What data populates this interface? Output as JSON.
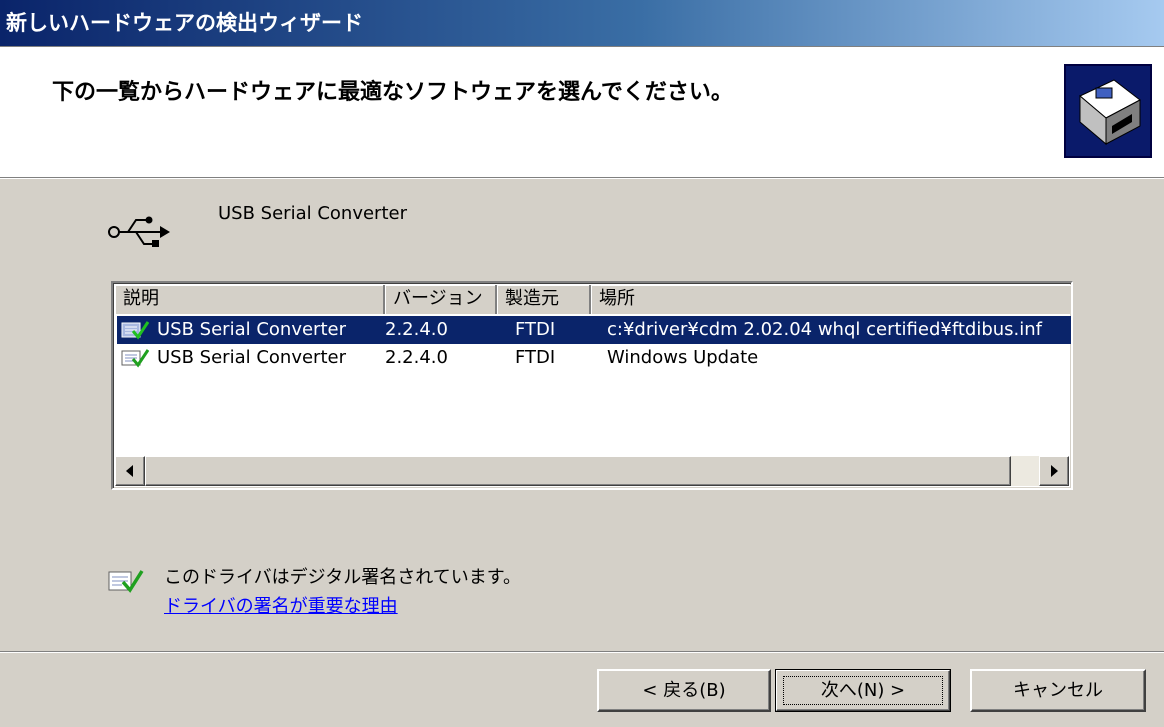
{
  "window": {
    "title": "新しいハードウェアの検出ウィザード"
  },
  "header": {
    "title": "下の一覧からハードウェアに最適なソフトウェアを選んでください。",
    "icon": "hardware-wizard-icon"
  },
  "device": {
    "name": "USB Serial Converter",
    "icon": "usb-icon"
  },
  "list": {
    "columns": [
      "説明",
      "バージョン",
      "製造元",
      "場所"
    ],
    "rows": [
      {
        "description": "USB Serial Converter",
        "version": "2.2.4.0",
        "manufacturer": "FTDI",
        "location": "c:¥driver¥cdm 2.02.04 whql certified¥ftdibus.inf",
        "selected": true,
        "icon": "signed-driver-icon"
      },
      {
        "description": "USB Serial Converter",
        "version": "2.2.4.0",
        "manufacturer": "FTDI",
        "location": "Windows Update",
        "selected": false,
        "icon": "signed-driver-icon"
      }
    ]
  },
  "signature": {
    "text": "このドライバはデジタル署名されています。",
    "link": "ドライバの署名が重要な理由",
    "icon": "signed-driver-icon"
  },
  "buttons": {
    "back": "< 戻る(B)",
    "next": "次へ(N) >",
    "cancel": "キャンセル"
  }
}
